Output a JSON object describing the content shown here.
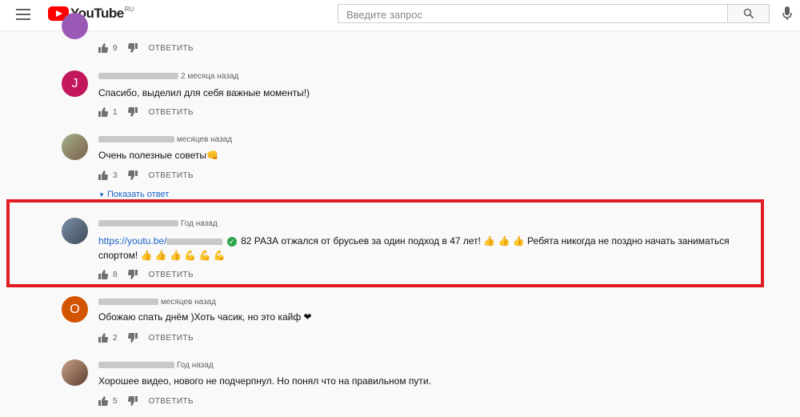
{
  "header": {
    "logo_text": "YouTube",
    "logo_region": "RU",
    "search_placeholder": "Введите запрос"
  },
  "colors": {
    "highlight_border": "#e11b22",
    "link": "#1a64c8",
    "brand_red": "#ff0000"
  },
  "comments": [
    {
      "time": "",
      "text": "",
      "likes": "9",
      "reply_label": "ОТВЕТИТЬ"
    },
    {
      "avatar_letter": "J",
      "time": "2 месяца назад",
      "text": "Спасибо, выделил для себя важные моменты!)",
      "likes": "1",
      "reply_label": "ОТВЕТИТЬ"
    },
    {
      "time": "месяцев назад",
      "text": "Очень полезные советы👊",
      "likes": "3",
      "reply_label": "ОТВЕТИТЬ",
      "show_replies": "Показать ответ"
    },
    {
      "time": "Год назад",
      "link_prefix": "https://youtu.be/",
      "text_line1": "82 РАЗА отжался от брусьев за один подход в 47 лет! 👍 👍 👍 Ребята никогда не поздно начать заниматься",
      "text_line2": "спортом! 👍 👍 👍 💪 💪 💪",
      "likes": "8",
      "reply_label": "ОТВЕТИТЬ"
    },
    {
      "avatar_letter": "O",
      "time": "месяцев назад",
      "text": "Обожаю спать днём )Хоть часик, но это кайф ❤",
      "likes": "2",
      "reply_label": "ОТВЕТИТЬ"
    },
    {
      "time": "Год назад",
      "text": "Хорошее видео, нового не подчерпнул. Но понял что на правильном пути.",
      "likes": "5",
      "reply_label": "ОТВЕТИТЬ"
    }
  ]
}
